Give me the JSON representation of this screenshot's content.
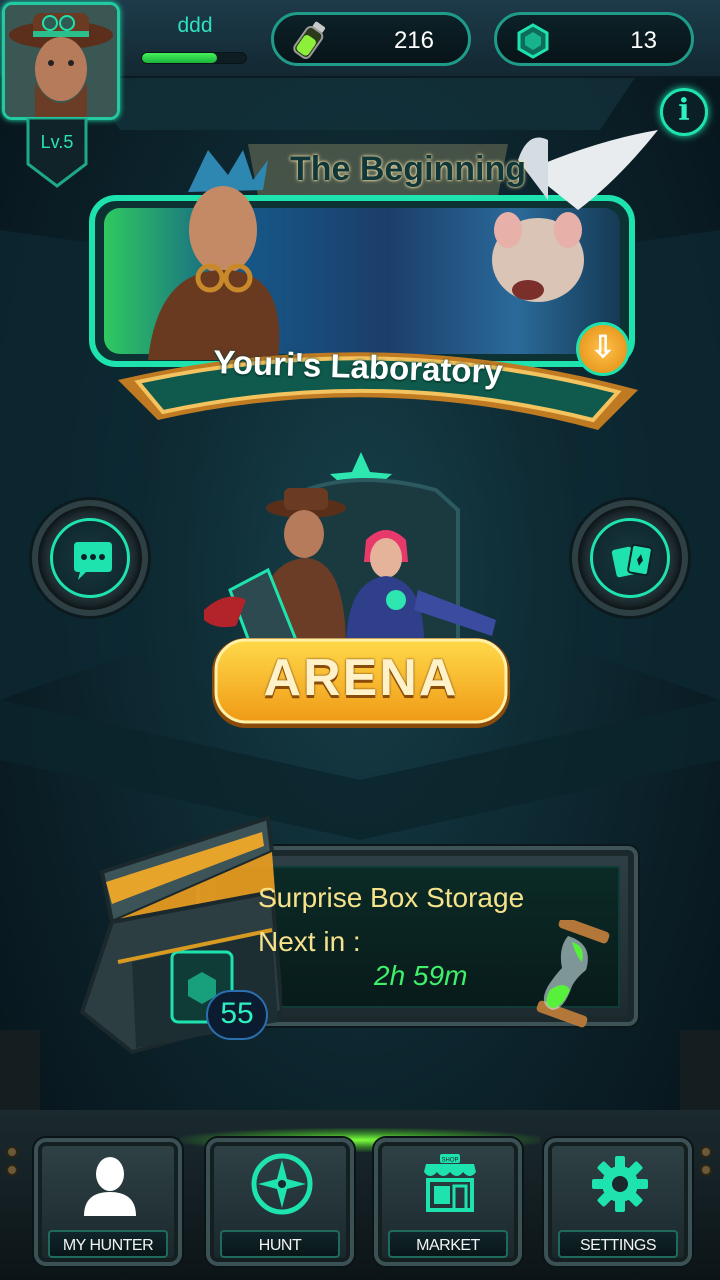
{
  "player": {
    "name": "ddd",
    "level_label": "Lv.5",
    "xp_fraction": 0.72
  },
  "currencies": [
    {
      "icon": "energy-vial-icon",
      "value": "216"
    },
    {
      "icon": "hex-gem-icon",
      "value": "13"
    }
  ],
  "info_button": {
    "label": "i"
  },
  "story": {
    "title": "The Beginning",
    "subtitle": "Youri's Laboratory",
    "download_icon": "download-arrow-icon"
  },
  "side_buttons": [
    {
      "icon": "chat-bubble-icon"
    },
    {
      "icon": "cards-icon"
    }
  ],
  "arena": {
    "label": "ARENA"
  },
  "surprise_box": {
    "title": "Surprise Box Storage",
    "next_label": "Next in :",
    "timer": "2h 59m",
    "count": "55"
  },
  "nav": {
    "items": [
      {
        "label": "MY HUNTER",
        "icon": "user-silhouette-icon"
      },
      {
        "label": "HUNT",
        "icon": "compass-icon"
      },
      {
        "label": "MARKET",
        "icon": "shop-icon",
        "icon_text": "SHOP"
      },
      {
        "label": "SETTINGS",
        "icon": "gear-icon"
      }
    ]
  },
  "colors": {
    "accent": "#1ee3ae",
    "gold": "#f5e28a",
    "timer_green": "#3ef06a",
    "xp_green": "#45f35a"
  }
}
